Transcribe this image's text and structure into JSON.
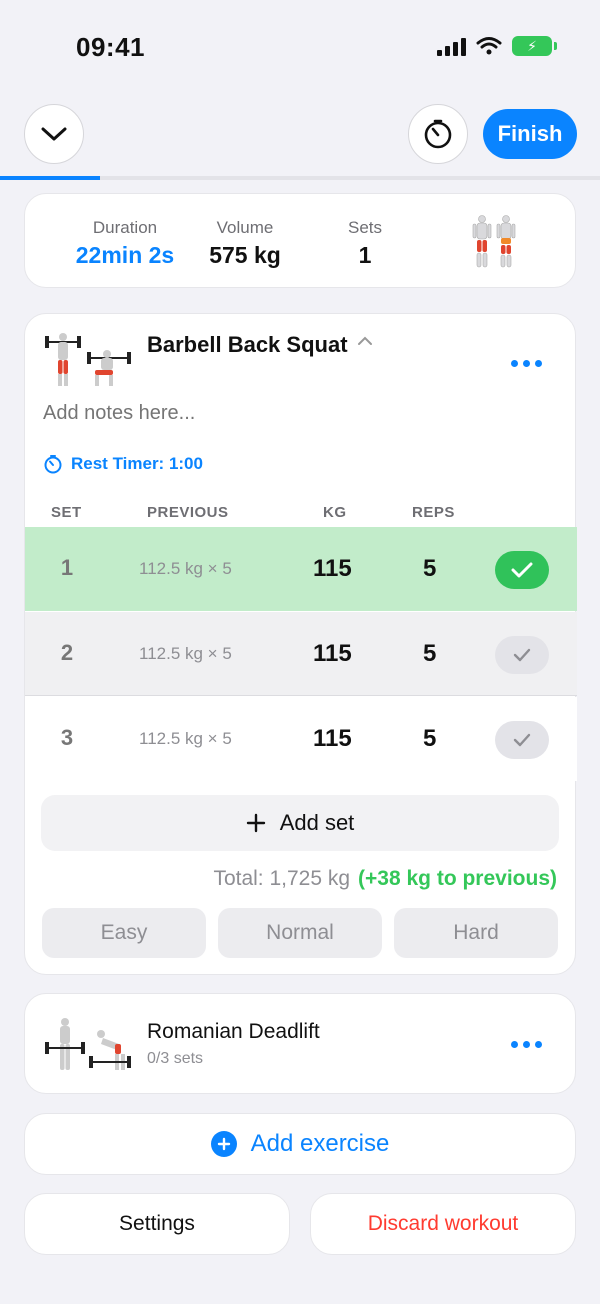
{
  "status_bar": {
    "time": "09:41"
  },
  "header": {
    "finish_label": "Finish",
    "progress": 0.167
  },
  "summary": {
    "duration_label": "Duration",
    "duration_value": "22min 2s",
    "volume_label": "Volume",
    "volume_value": "575 kg",
    "sets_label": "Sets",
    "sets_value": "1"
  },
  "exercise": {
    "title": "Barbell Back Squat",
    "notes_placeholder": "Add notes here...",
    "rest_timer": "Rest Timer: 1:00",
    "columns": {
      "set": "SET",
      "previous": "PREVIOUS",
      "kg": "KG",
      "reps": "REPS"
    },
    "sets": [
      {
        "num": "1",
        "previous": "112.5 kg × 5",
        "kg": "115",
        "reps": "5",
        "completed": true
      },
      {
        "num": "2",
        "previous": "112.5 kg × 5",
        "kg": "115",
        "reps": "5",
        "completed": false
      },
      {
        "num": "3",
        "previous": "112.5 kg × 5",
        "kg": "115",
        "reps": "5",
        "completed": false
      }
    ],
    "add_set_label": "Add set",
    "total_label": "Total: 1,725 kg",
    "total_diff": "(+38 kg to previous)",
    "difficulty": {
      "easy": "Easy",
      "normal": "Normal",
      "hard": "Hard"
    }
  },
  "exercise2": {
    "title": "Romanian Deadlift",
    "subtitle": "0/3 sets"
  },
  "add_exercise_label": "Add exercise",
  "footer": {
    "settings_label": "Settings",
    "discard_label": "Discard workout"
  },
  "colors": {
    "accent": "#0a84ff",
    "success": "#34c759",
    "danger": "#ff3b30",
    "completed_row": "#c2ecca"
  }
}
